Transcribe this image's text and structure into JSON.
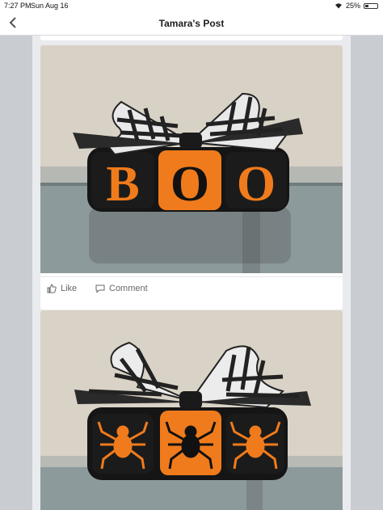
{
  "status": {
    "time": "7:27 PM",
    "date": "Sun Aug 16",
    "battery": "25%"
  },
  "nav": {
    "title": "Tamara's Post"
  },
  "posts": [
    {
      "photo": {
        "blocks": [
          "B",
          "O",
          "O"
        ],
        "description_icon": "boo-blocks-photo"
      },
      "actions": {
        "like": "Like",
        "comment": "Comment"
      }
    },
    {
      "photo": {
        "blocks": [
          "spider",
          "spider",
          "spider"
        ],
        "description_icon": "spider-blocks-photo"
      }
    }
  ],
  "colors": {
    "orange": "#f07b1c",
    "black": "#141414",
    "wall": "#d9d2c6",
    "shelf": "#8e9c9e"
  }
}
